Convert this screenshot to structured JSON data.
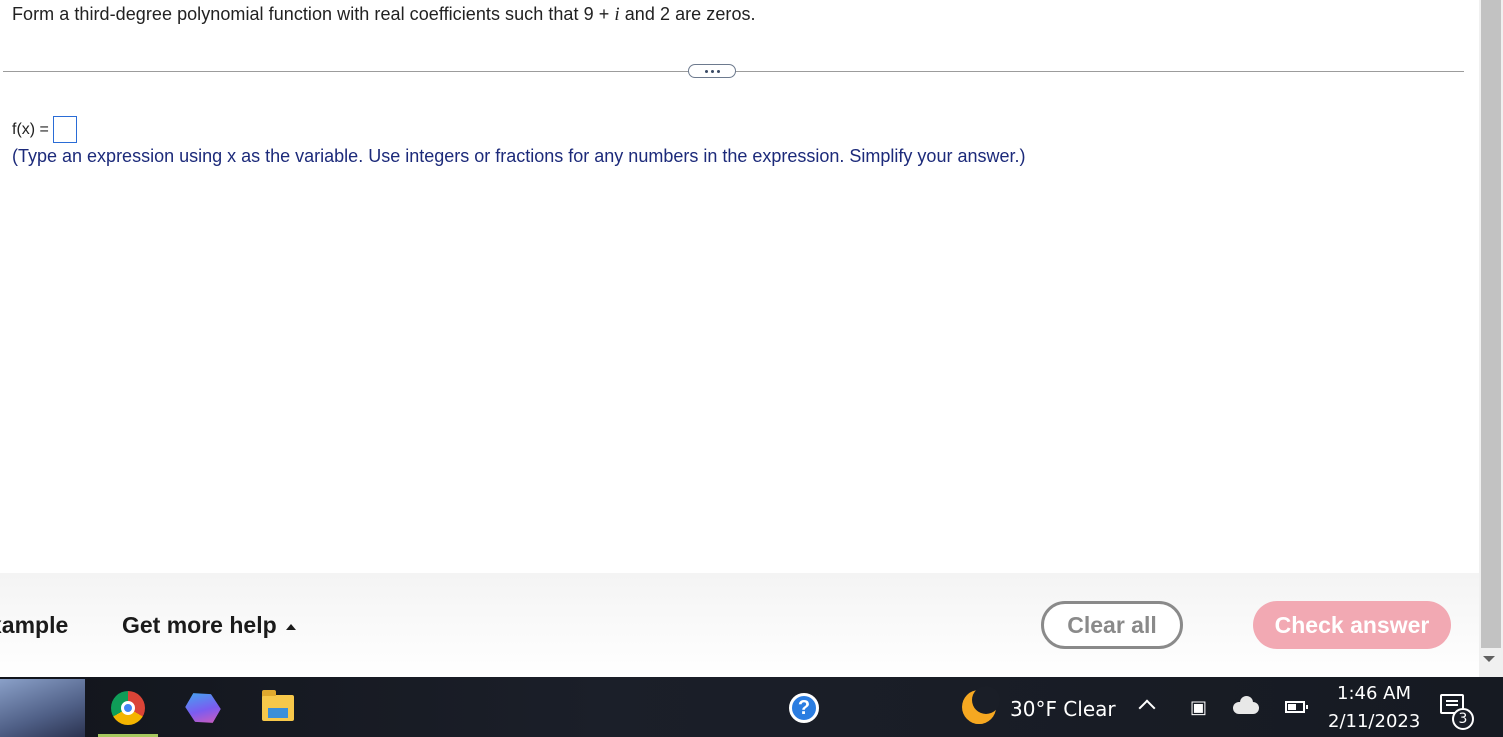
{
  "question": {
    "prefix": "Form a third-degree polynomial function with real coefficients such that 9 + ",
    "imag_unit": "i",
    "suffix": " and 2 are zeros."
  },
  "answer": {
    "label": "f(x) =",
    "value": ""
  },
  "hint": "(Type an expression using x as the variable. Use integers or fractions for any numbers in the expression. Simplify your answer.)",
  "footer": {
    "example_label": "xample",
    "help_label": "Get more help",
    "clear_label": "Clear all",
    "check_label": "Check answer"
  },
  "taskbar": {
    "weather": "30°F  Clear",
    "time": "1:46 AM",
    "date": "2/11/2023",
    "notification_count": "3",
    "help_glyph": "?"
  },
  "icons": [
    "search-icon",
    "chrome-icon",
    "copilot-icon",
    "file-explorer-icon",
    "help-icon",
    "moon-icon",
    "chevron-up-icon",
    "meet-now-icon",
    "onedrive-icon",
    "battery-icon",
    "notification-icon"
  ],
  "colors": {
    "hint_text": "#1c2a7a",
    "check_button": "#f2a9b3",
    "answer_box_border": "#2a6cd6",
    "taskbar": "#1a1e27"
  }
}
